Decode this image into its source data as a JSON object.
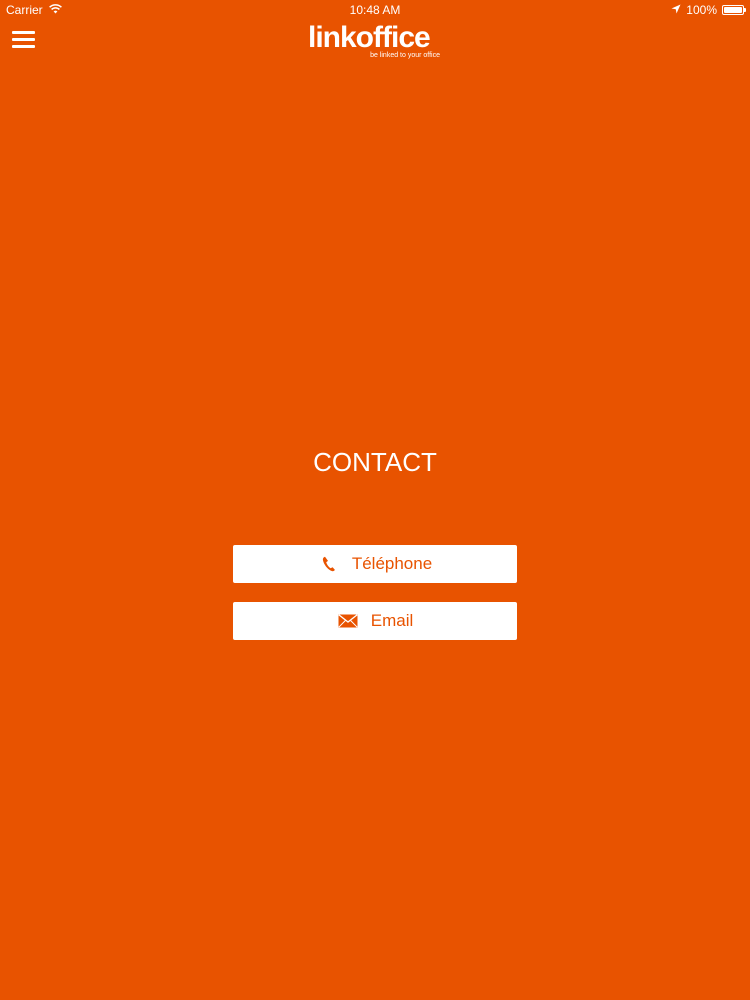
{
  "status_bar": {
    "carrier": "Carrier",
    "time": "10:48 AM",
    "battery": "100%",
    "battery_level": 1.0,
    "icons": [
      "wifi-icon",
      "location-arrow-icon",
      "battery-icon"
    ]
  },
  "nav": {
    "menu_icon": "hamburger-menu-icon",
    "logo_name": "linkoffice",
    "logo_tagline": "be linked to your office"
  },
  "content": {
    "title": "CONTACT",
    "buttons": [
      {
        "label": "Téléphone",
        "icon": "phone-icon"
      },
      {
        "label": "Email",
        "icon": "envelope-icon"
      }
    ]
  },
  "colors": {
    "background": "#E85300",
    "button_background": "#FFFFFF",
    "button_text": "#E85300"
  }
}
